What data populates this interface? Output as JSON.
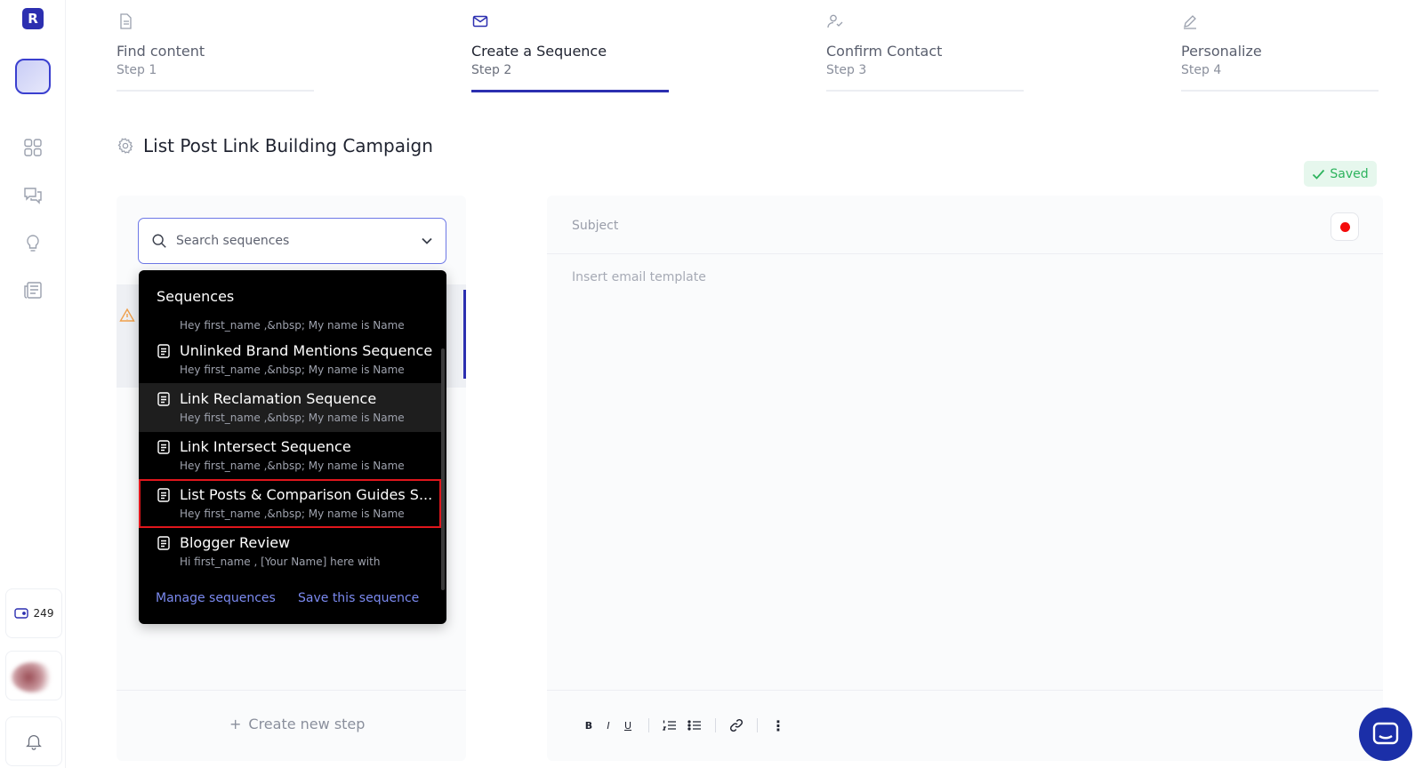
{
  "app": {
    "logo_letter": "R"
  },
  "sidebar": {
    "icons": [
      "dashboard-icon",
      "chat-icon",
      "lightbulb-icon",
      "newspaper-icon"
    ],
    "credits": "249"
  },
  "stepper": [
    {
      "title": "Find content",
      "step": "Step 1",
      "icon": "document-icon"
    },
    {
      "title": "Create a Sequence",
      "step": "Step 2",
      "icon": "mail-icon"
    },
    {
      "title": "Confirm Contact",
      "step": "Step 3",
      "icon": "user-check-icon"
    },
    {
      "title": "Personalize",
      "step": "Step 4",
      "icon": "pencil-icon"
    }
  ],
  "campaign": {
    "title": "List Post Link Building Campaign",
    "saved_label": "Saved"
  },
  "search": {
    "placeholder": "Search sequences"
  },
  "dropdown": {
    "heading": "Sequences",
    "first_preview": "Hey first_name ,&nbsp; My name is Name",
    "items": [
      {
        "name": "Unlinked Brand Mentions Sequence",
        "preview": "Hey first_name ,&nbsp; My name is Name"
      },
      {
        "name": "Link Reclamation Sequence",
        "preview": "Hey first_name ,&nbsp; My name is Name"
      },
      {
        "name": "Link Intersect Sequence",
        "preview": "Hey first_name ,&nbsp; My name is Name"
      },
      {
        "name": "List Posts & Comparison Guides S...",
        "preview": "Hey first_name ,&nbsp; My name is Name"
      },
      {
        "name": "Blogger Review",
        "preview": "Hi first_name , [Your Name] here with"
      }
    ],
    "manage_label": "Manage sequences",
    "save_label": "Save this sequence"
  },
  "steps_panel": {
    "create_label": "Create new step",
    "plus": "+"
  },
  "editor": {
    "subject_placeholder": "Subject",
    "template_placeholder": "Insert email template",
    "toolbar": {
      "bold": "B",
      "italic": "I",
      "underline": "U",
      "more": "⋮"
    }
  },
  "colors": {
    "accent": "#2c2fb0",
    "saved_green": "#2db35d",
    "record_red": "#f40b0b",
    "highlight_red": "#e0161c"
  }
}
